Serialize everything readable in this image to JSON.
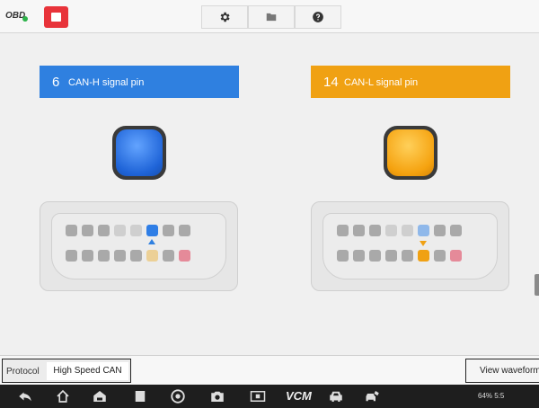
{
  "toolbar": {
    "connection_label": "OBD",
    "icons": [
      "stop-icon",
      "gear-icon",
      "folder-icon",
      "help-icon"
    ]
  },
  "pins": [
    {
      "number": "6",
      "label": "CAN-H signal pin",
      "color": "#2f80e0"
    },
    {
      "number": "14",
      "label": "CAN-L signal pin",
      "color": "#f0a113"
    }
  ],
  "protocol": {
    "label": "Protocol",
    "value": "High Speed CAN"
  },
  "actions": {
    "view_waveform": "View waveform"
  },
  "navbar": {
    "vcm_label": "VCM",
    "status": "64% 5:5"
  }
}
